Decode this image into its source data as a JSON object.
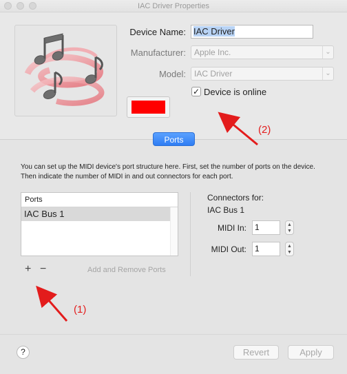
{
  "window": {
    "title": "IAC Driver Properties"
  },
  "device": {
    "name_label": "Device Name:",
    "name_value": "IAC Driver",
    "manufacturer_label": "Manufacturer:",
    "manufacturer_value": "Apple Inc.",
    "model_label": "Model:",
    "model_value": "IAC Driver",
    "online_label": "Device is online",
    "online_checked": true,
    "icon": "music-notes-icon",
    "swatch_color": "#ff0000"
  },
  "tabs": {
    "ports_label": "Ports"
  },
  "ports": {
    "info_text": "You can set up the MIDI device's port structure here. First, set the number of ports on the device. Then indicate the number of MIDI in and out connectors for each port.",
    "column_header": "Ports",
    "items": [
      {
        "label": "IAC Bus 1"
      }
    ],
    "add_symbol": "+",
    "remove_symbol": "−",
    "add_remove_label": "Add and Remove Ports"
  },
  "connectors": {
    "title": "Connectors for:",
    "port_name": "IAC Bus 1",
    "midi_in_label": "MIDI In:",
    "midi_in_value": "1",
    "midi_out_label": "MIDI Out:",
    "midi_out_value": "1"
  },
  "footer": {
    "help_label": "?",
    "revert_label": "Revert",
    "apply_label": "Apply"
  },
  "annotations": {
    "label_1": "(1)",
    "label_2": "(2)",
    "color": "#e31c1c"
  }
}
